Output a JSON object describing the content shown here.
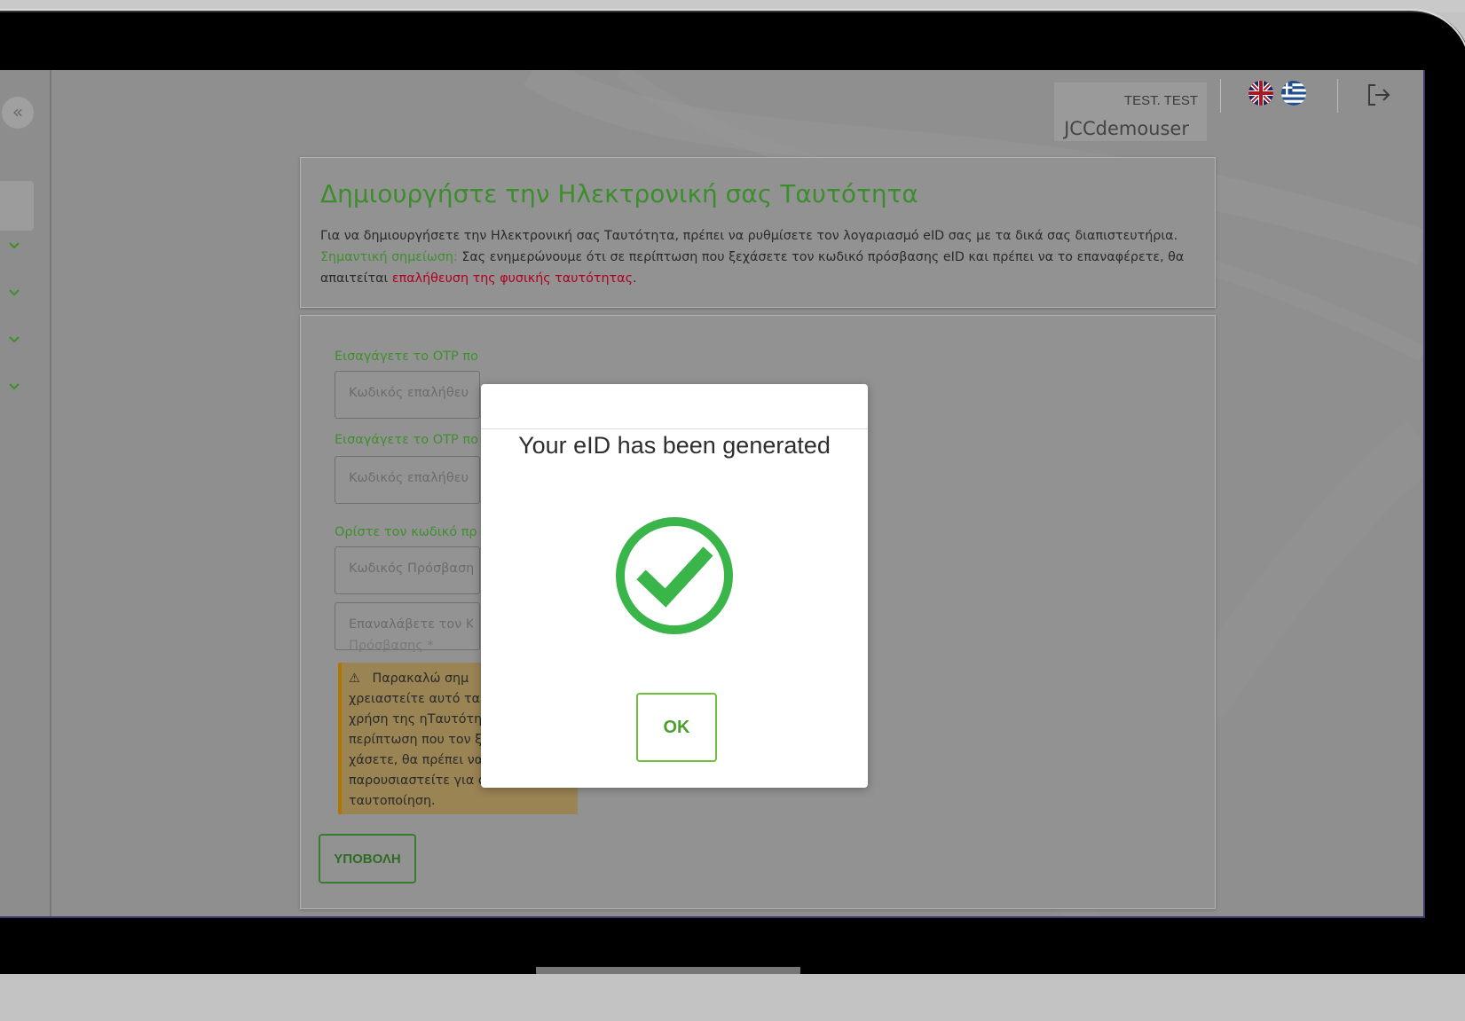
{
  "header": {
    "user_top": "TEST. TEST",
    "username": "JCCdemouser"
  },
  "sidebar": {
    "collapse_glyph": "«"
  },
  "intro": {
    "title": "Δημιουργήστε την Ηλεκτρονική σας Ταυτότητα",
    "line1": "Για να δημιουργήσετε την Ηλεκτρονική σας Ταυτότητα, πρέπει να ρυθμίσετε τον λογαριασμό eID σας με τα δικά σας διαπιστευτήρια.",
    "note_label": "Σημαντική σημείωση:",
    "note_text": " Σας ενημερώνουμε ότι σε περίπτωση που ξεχάσετε τον κωδικό πρόσβασης eID και πρέπει να το επαναφέρετε, θα απαιτείται ",
    "note_link": "επαλήθευση της φυσικής ταυτότητας",
    "note_end": "."
  },
  "form": {
    "label_otp1": "Εισαγάγετε το OTP πο",
    "placeholder_otp1": "Κωδικός επαλήθευ",
    "label_otp2": "Εισαγάγετε το OTP πο",
    "placeholder_otp2": "Κωδικός επαλήθευ",
    "label_password": "Ορίστε τον κωδικό πρ",
    "placeholder_password": "Κωδικός Πρόσβαση",
    "placeholder_repeat_1": "Επαναλάβετε τον Κ",
    "placeholder_repeat_2": "Πρόσβασης *",
    "warning_icon": "⚠",
    "warning_lines": [
      "Παρακαλώ σημ",
      "χρειαστείτε αυτό τα",
      "χρήση της ηΤαυτότητας σας. Σε",
      "περίπτωση που τον ξεχάσετε ή",
      "χάσετε, θα πρέπει να",
      "παρουσιαστείτε για φυσική",
      "ταυτοποίηση."
    ],
    "submit_label": "ΥΠΟΒΟΛΗ"
  },
  "modal": {
    "message": "Your eID has been generated",
    "ok_label": "OK"
  },
  "colors": {
    "accent_green": "#3f8f2e",
    "success_green": "#3ab54a",
    "link_red": "#b00020",
    "warning_bg": "#9a8454"
  },
  "icons": [
    "collapse-icon",
    "chevron-down-icon",
    "uk-flag-icon",
    "greek-flag-icon",
    "logout-icon",
    "warning-icon",
    "success-check-icon"
  ]
}
